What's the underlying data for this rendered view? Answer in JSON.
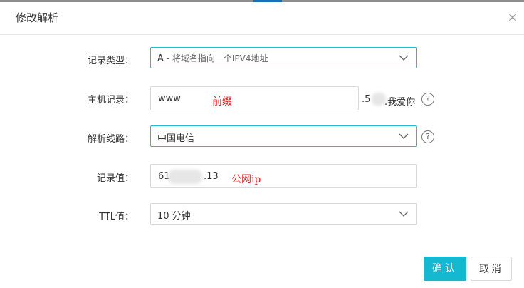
{
  "dialog": {
    "title": "修改解析",
    "close_label": "×"
  },
  "form": {
    "record_type": {
      "label": "记录类型：",
      "value": "A",
      "hint": " - 将域名指向一个IPV4地址"
    },
    "host_record": {
      "label": "主机记录：",
      "value": "www",
      "annotation": "前缀",
      "domain_prefix": ".5",
      "domain_suffix": ".我爱你",
      "help": "?"
    },
    "resolve_line": {
      "label": "解析线路：",
      "value": "中国电信",
      "help": "?"
    },
    "record_value": {
      "label": "记录值：",
      "value_start": "61",
      "value_end": ".13",
      "annotation": "公网ip"
    },
    "ttl": {
      "label": "TTL值：",
      "value": "10 分钟"
    }
  },
  "buttons": {
    "confirm": "确认",
    "cancel": "取消"
  },
  "colors": {
    "accent": "#14b8d0",
    "annotation": "#e02020",
    "border": "#d9d9d9"
  }
}
